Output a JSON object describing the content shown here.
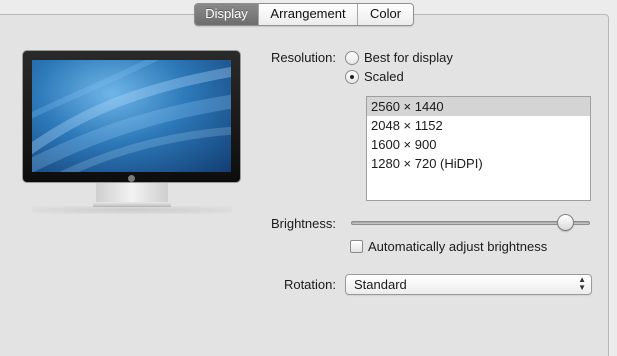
{
  "tabs": [
    {
      "label": "Display",
      "active": true
    },
    {
      "label": "Arrangement",
      "active": false
    },
    {
      "label": "Color",
      "active": false
    }
  ],
  "resolution": {
    "label": "Resolution:",
    "options": [
      {
        "label": "Best for display",
        "selected": false
      },
      {
        "label": "Scaled",
        "selected": true
      }
    ],
    "list": [
      {
        "label": "2560 × 1440",
        "selected": true
      },
      {
        "label": "2048 × 1152",
        "selected": false
      },
      {
        "label": "1600 × 900",
        "selected": false
      },
      {
        "label": "1280 × 720 (HiDPI)",
        "selected": false
      }
    ]
  },
  "brightness": {
    "label": "Brightness:",
    "level": 0.93,
    "auto_label": "Automatically adjust brightness",
    "auto_checked": false
  },
  "rotation": {
    "label": "Rotation:",
    "value": "Standard"
  },
  "colors": {
    "panel": "#e3e3e3",
    "window": "#ececec",
    "active_tab": "#7b7b7b",
    "selected_row": "#d4d4d4"
  }
}
